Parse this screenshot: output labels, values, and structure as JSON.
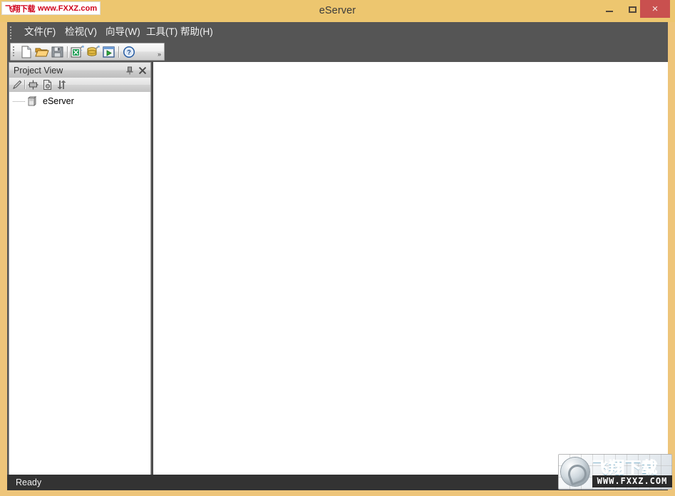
{
  "window": {
    "title": "eServer",
    "controls": {
      "minimize": "Minimize",
      "maximize": "Maximize",
      "close": "×"
    },
    "frame_color": "#edc66f",
    "close_color": "#c9504f",
    "chrome_color": "#555555"
  },
  "menu": {
    "items": [
      {
        "label": "文件(F)",
        "name": "menu-file"
      },
      {
        "label": "检视(V)",
        "name": "menu-view"
      },
      {
        "label": "向导(W)",
        "name": "menu-wizard"
      },
      {
        "label": "工具(T)",
        "name": "menu-tools"
      },
      {
        "label": "帮助(H)",
        "name": "menu-help"
      }
    ]
  },
  "toolbar": {
    "buttons": [
      {
        "name": "new-file-icon",
        "tip": "New"
      },
      {
        "name": "open-folder-icon",
        "tip": "Open"
      },
      {
        "name": "save-disk-icon",
        "tip": "Save"
      },
      {
        "name": "excel-wizard-icon",
        "tip": "Data Wizard"
      },
      {
        "name": "database-wizard-icon",
        "tip": "Database Wizard"
      },
      {
        "name": "run-play-icon",
        "tip": "Run"
      },
      {
        "name": "help-question-icon",
        "tip": "Help"
      }
    ],
    "overflow_label": "»"
  },
  "project_panel": {
    "title": "Project View",
    "pin_label": "↯",
    "close_label": "✕",
    "toolbar_buttons": [
      {
        "name": "pencil-edit-icon",
        "tip": "Edit"
      },
      {
        "name": "properties-icon",
        "tip": "Properties"
      },
      {
        "name": "new-document-icon",
        "tip": "New Item"
      },
      {
        "name": "refresh-sync-icon",
        "tip": "Refresh"
      }
    ],
    "tree": {
      "root": {
        "label": "eServer",
        "icon": "server-box-icon"
      }
    }
  },
  "workspace": {
    "background": "#ffffff"
  },
  "status_bar": {
    "message": "Ready"
  },
  "watermarks": {
    "top": {
      "cn": "飞翔下载",
      "url": "www.FXXZ.com",
      "color": "#d0021b"
    },
    "bottom": {
      "cn": "飞翔下载",
      "url": "WWW.FXXZ.COM",
      "color": "#26a8e0"
    }
  }
}
